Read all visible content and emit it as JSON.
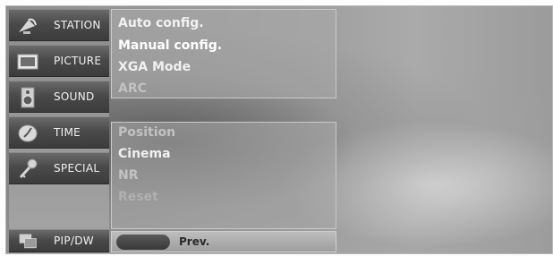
{
  "sidebar": {
    "items": [
      {
        "label": "STATION",
        "icon": "satellite-dish-icon"
      },
      {
        "label": "PICTURE",
        "icon": "tv-screen-icon"
      },
      {
        "label": "SOUND",
        "icon": "speaker-icon"
      },
      {
        "label": "TIME",
        "icon": "clock-icon"
      },
      {
        "label": "SPECIAL",
        "icon": "key-icon"
      }
    ],
    "pip": {
      "label": "PIP/DW",
      "icon": "pip-windows-icon"
    }
  },
  "menu": {
    "group1": [
      "Auto config.",
      "Manual config.",
      "XGA Mode",
      "ARC"
    ],
    "group2": [
      "Position",
      "Cinema",
      "NR",
      "Reset"
    ]
  },
  "footer": {
    "prev_label": "Prev."
  }
}
